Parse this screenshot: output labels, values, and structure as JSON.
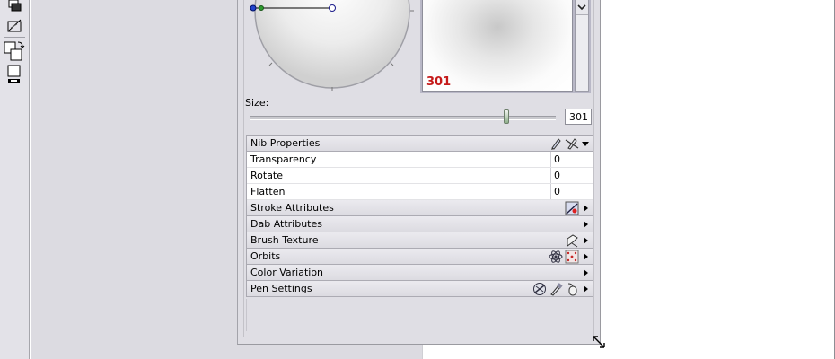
{
  "toolbar": {
    "tools": [
      "layer-stack-icon",
      "transform-icon",
      "fill-stroke-swatch-icon",
      "color-swatch-icon"
    ]
  },
  "brush_panel": {
    "preview": {
      "value": "301",
      "value_color": "#c51a1a",
      "scroll_down_glyph": "⌄"
    },
    "size": {
      "label": "Size:",
      "value": "301",
      "slider_fraction": 0.84
    },
    "sections": [
      {
        "label": "Nib Properties",
        "expanded": true,
        "icons": [
          "pen-nib-icon",
          "pen-nib-off-icon"
        ],
        "arrow": "down",
        "rows": [
          {
            "label": "Transparency",
            "value": "0"
          },
          {
            "label": "Rotate",
            "value": "0"
          },
          {
            "label": "Flatten",
            "value": "0"
          }
        ]
      },
      {
        "label": "Stroke Attributes",
        "icons": [
          "stroke-attributes-icon"
        ],
        "arrow": "right"
      },
      {
        "label": "Dab Attributes",
        "icons": [],
        "arrow": "right"
      },
      {
        "label": "Brush Texture",
        "icons": [
          "brush-texture-icon"
        ],
        "arrow": "right"
      },
      {
        "label": "Orbits",
        "icons": [
          "orbit-atom-icon",
          "orbit-pattern-icon"
        ],
        "arrow": "right"
      },
      {
        "label": "Color Variation",
        "icons": [],
        "arrow": "right"
      },
      {
        "label": "Pen Settings",
        "icons": [
          "pen-tilt-icon",
          "pen-eraser-icon",
          "pen-mouse-icon"
        ],
        "arrow": "right"
      }
    ]
  },
  "colors": {
    "accent_red": "#c51a1a",
    "panel_bg": "#dfdee4",
    "slider_thumb": "#8eb08a"
  }
}
